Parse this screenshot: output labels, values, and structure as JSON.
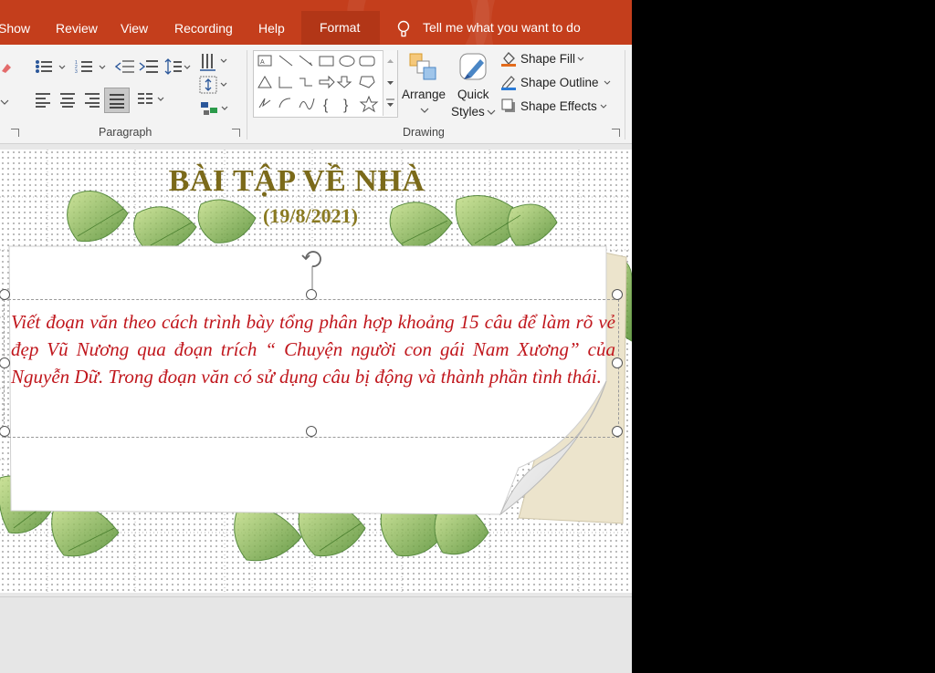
{
  "tabs": [
    "Show",
    "Review",
    "View",
    "Recording",
    "Help"
  ],
  "active_tab": "Format",
  "tell_me": "Tell me what you want to do",
  "ribbon": {
    "paragraph_label": "Paragraph",
    "drawing_label": "Drawing",
    "arrange_label": "Arrange",
    "quick_styles_line1": "Quick",
    "quick_styles_line2": "Styles",
    "shape_fill": "Shape Fill",
    "shape_outline": "Shape Outline",
    "shape_effects": "Shape Effects"
  },
  "slide": {
    "title": "BÀI TẬP VỀ NHÀ",
    "date": "(19/8/2021)",
    "body": "Viết đoạn văn theo cách trình bày tổng phân hợp khoảng 15 câu để làm rõ vẻ đẹp Vũ Nương qua đoạn trích “ Chuyện người con gái Nam Xương” của Nguyễn Dữ. Trong đoạn văn có sử dụng câu bị động và thành phần tình thái."
  },
  "colors": {
    "ribbon_accent": "#c43e1c",
    "title_color": "#7b6a1a",
    "body_color": "#c0161c"
  }
}
